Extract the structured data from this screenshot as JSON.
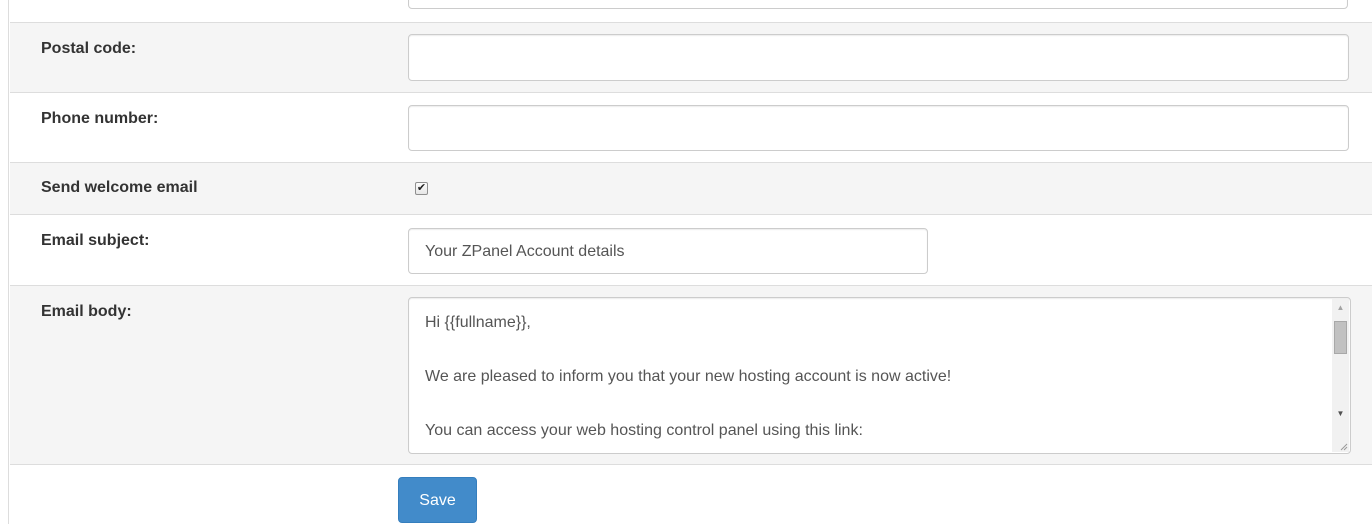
{
  "form": {
    "postal_code": {
      "label": "Postal code:",
      "value": ""
    },
    "phone_number": {
      "label": "Phone number:",
      "value": ""
    },
    "welcome_email": {
      "label": "Send welcome email",
      "checked": true
    },
    "email_subject": {
      "label": "Email subject:",
      "value": "Your ZPanel Account details"
    },
    "email_body": {
      "label": "Email body:",
      "lines": [
        "Hi {{fullname}},",
        "",
        "We are pleased to inform you that your new hosting account is now active!",
        "",
        "You can access your web hosting control panel using this link:"
      ]
    },
    "save_label": "Save"
  },
  "colors": {
    "primary": "#428bca",
    "row_shade": "#f5f5f5",
    "border": "#dddddd"
  }
}
